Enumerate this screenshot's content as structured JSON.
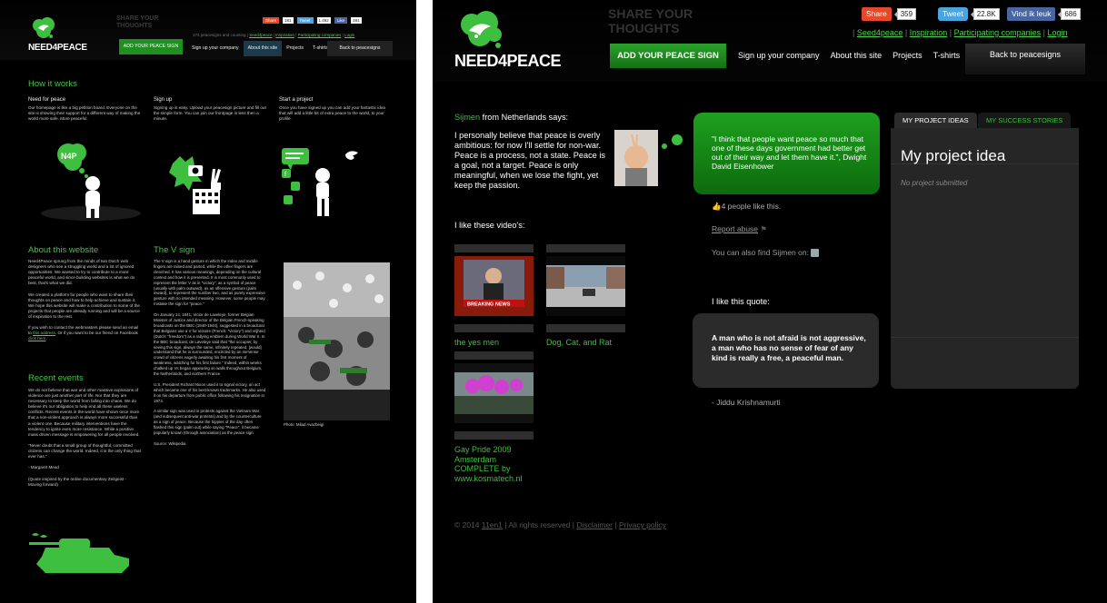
{
  "left": {
    "logo_text": "NEED4PEACE",
    "share_thoughts": "SHARE YOUR THOUGHTS",
    "counter": "174 peacesigns and counting",
    "toplinks": [
      "Seed4peace",
      "Inspiration",
      "Participating companies",
      "Login"
    ],
    "share": {
      "share": "Share",
      "share_count": "181",
      "tweet": "Tweet",
      "tweet_count": "1,462",
      "like": "Like",
      "like_count": "481"
    },
    "nav": {
      "add": "ADD YOUR PEACE SIGN",
      "items": [
        "Sign up your company",
        "About this site",
        "Projects",
        "T-shirts"
      ],
      "back": "Back to peacesigns"
    },
    "how_title": "How it works",
    "cols": [
      {
        "title": "Need for peace",
        "text": "Our homepage is like a big petition board. Everyone on the site is showing their support for a different way of making the world more safe. More peaceful."
      },
      {
        "title": "Sign up",
        "text": "Signing up is easy. Upload your peacesign picture and fill out the simple form. You can join our frontpage in less then a minute."
      },
      {
        "title": "Start a project",
        "text": "Once you have signed up you can add your fantastic idea that will add a little bit of extra peace to the world, to your profile."
      }
    ],
    "n4p_badge": "N4P",
    "about_title": "About this website",
    "about_text": "Need4Peace sprung from the minds of two Dutch web designers who see a struggling world and a lot of ignored opportunities. We wanted to try to contribute to a more peaceful world, and since building websites is what we do best, that's what we did.",
    "about_text2": "We created a platform for people who want to share their thoughts on peace and how to help achieve and sustain it. We hope this website will make a contribution to some of the projects that people are already running and will be a source of inspiration to the rest.",
    "about_text3a": "If you wish to contact the webmasters please send an email to ",
    "about_link1": "this address",
    "about_text3b": ". Or if you want to be our friend on Facebook ",
    "about_link2": "click here",
    "about_text3c": ".",
    "recent_title": "Recent events",
    "recent_text": "We do not believe that war and other massive explosions of violence are just another part of life. Nor that they are necessary to keep the world from falling into chaos. We do believe it's our obligation to help end all these useless conflicts. Recent events in the world have shown once more that a non-violent approach is always more successful than a violent one. Because military interventions have the tendency to ignite even more resistance. While a positive mass driven message is empowering for all people involved.",
    "recent_quote": "\"Never doubt that a small group of thoughtful, committed citizens can change the world. Indeed, it is the only thing that ever has.\"",
    "recent_author": "- Margaret Mead",
    "recent_source": "(Quote inspired by the online documentary Zeitgeist - Moving forward)",
    "vsign_title": "The V sign",
    "vsign_p1": "The V sign is a hand gesture in which the index and middle fingers are raised and parted, while the other fingers are clenched. It has various meanings, depending on the cultural context and how it is presented. It is most commonly used to represent the letter V as in \"victory\", as a symbol of peace (usually with palm outward), as an offensive gesture (palm inward), to represent the number two, and as purely expressive gesture with no intended meaning. However, some people may mistake the sign for \"peace.\"",
    "vsign_p2": "On January 14, 1941, Victor de Laveleye, former Belgian Minister of Justice and director of the Belgian French-speaking broadcasts on the BBC (1940-1944), suggested in a broadcast that Belgians use a V for victoire (French: \"victory\") and vrijheid (Dutch: \"freedom\") as a rallying emblem during World War II. In the BBC broadcast, de Laveleye said that \"the occupier, by seeing this sign, always the same, infinitely repeated, [would] understand that he is surrounded, encircled by an immense crowd of citizens eagerly awaiting his first moment of weakness, watching for his first failure.\" Indeed, within weeks chalked up Vs began appearing on walls throughout Belgium, the Netherlands, and northern France",
    "vsign_p3": "U.S. President Richard Nixon used it to signal victory, an act which became one of his best-known trademarks. He also used it on his departure from public office following his resignation in 1974.",
    "vsign_p4": "A similar sign was used in protests against the Vietnam War (and subsequent anti-war protests) and by the counterculture as a sign of peace. Because the hippies of the day often flashed this sign (palm out) while saying \"Peace\", it became popularly known (through association) as the peace sign",
    "vsign_source": "Source: Wikipedia",
    "photo_caption": "Photo: Milad Avazbeigi"
  },
  "right": {
    "logo_text": "NEED4PEACE",
    "share_thoughts_1": "SHARE YOUR",
    "share_thoughts_2": "THOUGHTS",
    "share": {
      "share": "Share",
      "share_count": "359",
      "tweet": "Tweet",
      "tweet_count": "22.8K",
      "like": "Vind ik leuk",
      "like_count": "686"
    },
    "toplinks": [
      "Seed4peace",
      "Inspiration",
      "Participating companies",
      "Login"
    ],
    "nav": {
      "add": "ADD YOUR PEACE SIGN",
      "items": [
        "Sign up your company",
        "About this site",
        "Projects",
        "T-shirts"
      ],
      "back": "Back to peacesigns"
    },
    "author_name": "Sijmen",
    "author_from": " from Netherlands says:",
    "statement": "I personally believe that peace is overly ambitious: for now I'll settle for non-war. Peace is a process, not a state. Peace is a goal, not a target. Peace is only meaningful, when we lose the fight, yet keep the passion.",
    "bubble_quote": "\"I think that people want peace so much that one of these days government had better get out of their way and let them have it.\", Dwight David Eisenhower",
    "likes": "4 people like this.",
    "report": "Report abuse",
    "find_on": "You can also find Sijmen on:",
    "videos_title": "I like these video's:",
    "videos": [
      {
        "title": "the yes men",
        "badge": "BREAKING NEWS"
      },
      {
        "title": "Dog, Cat, and Rat"
      },
      {
        "title": "Gay Pride 2009 Amsterdam COMPLETE by www.kosmatech.nl"
      }
    ],
    "quote_title": "I like this quote:",
    "quote_text": "A man who is not afraid is not aggressive, a man who has no sense of fear of any kind is really a free, a peaceful man.",
    "quote_author": "- Jiddu Krishnamurti",
    "tabs": [
      "MY PROJECT IDEAS",
      "MY SUCCESS STORIES"
    ],
    "project_title": "My project idea",
    "project_empty": "No project submitted",
    "footer": {
      "copyright": "© 2014 ",
      "company": "11en1",
      "rights": " | All rights reserved | ",
      "disclaimer": "Disclaimer",
      "sep": " | ",
      "privacy": "Privacy policy"
    }
  },
  "colors": {
    "accent": "#3fbf3f",
    "button": "#1f8f1f",
    "bg": "#000000"
  }
}
